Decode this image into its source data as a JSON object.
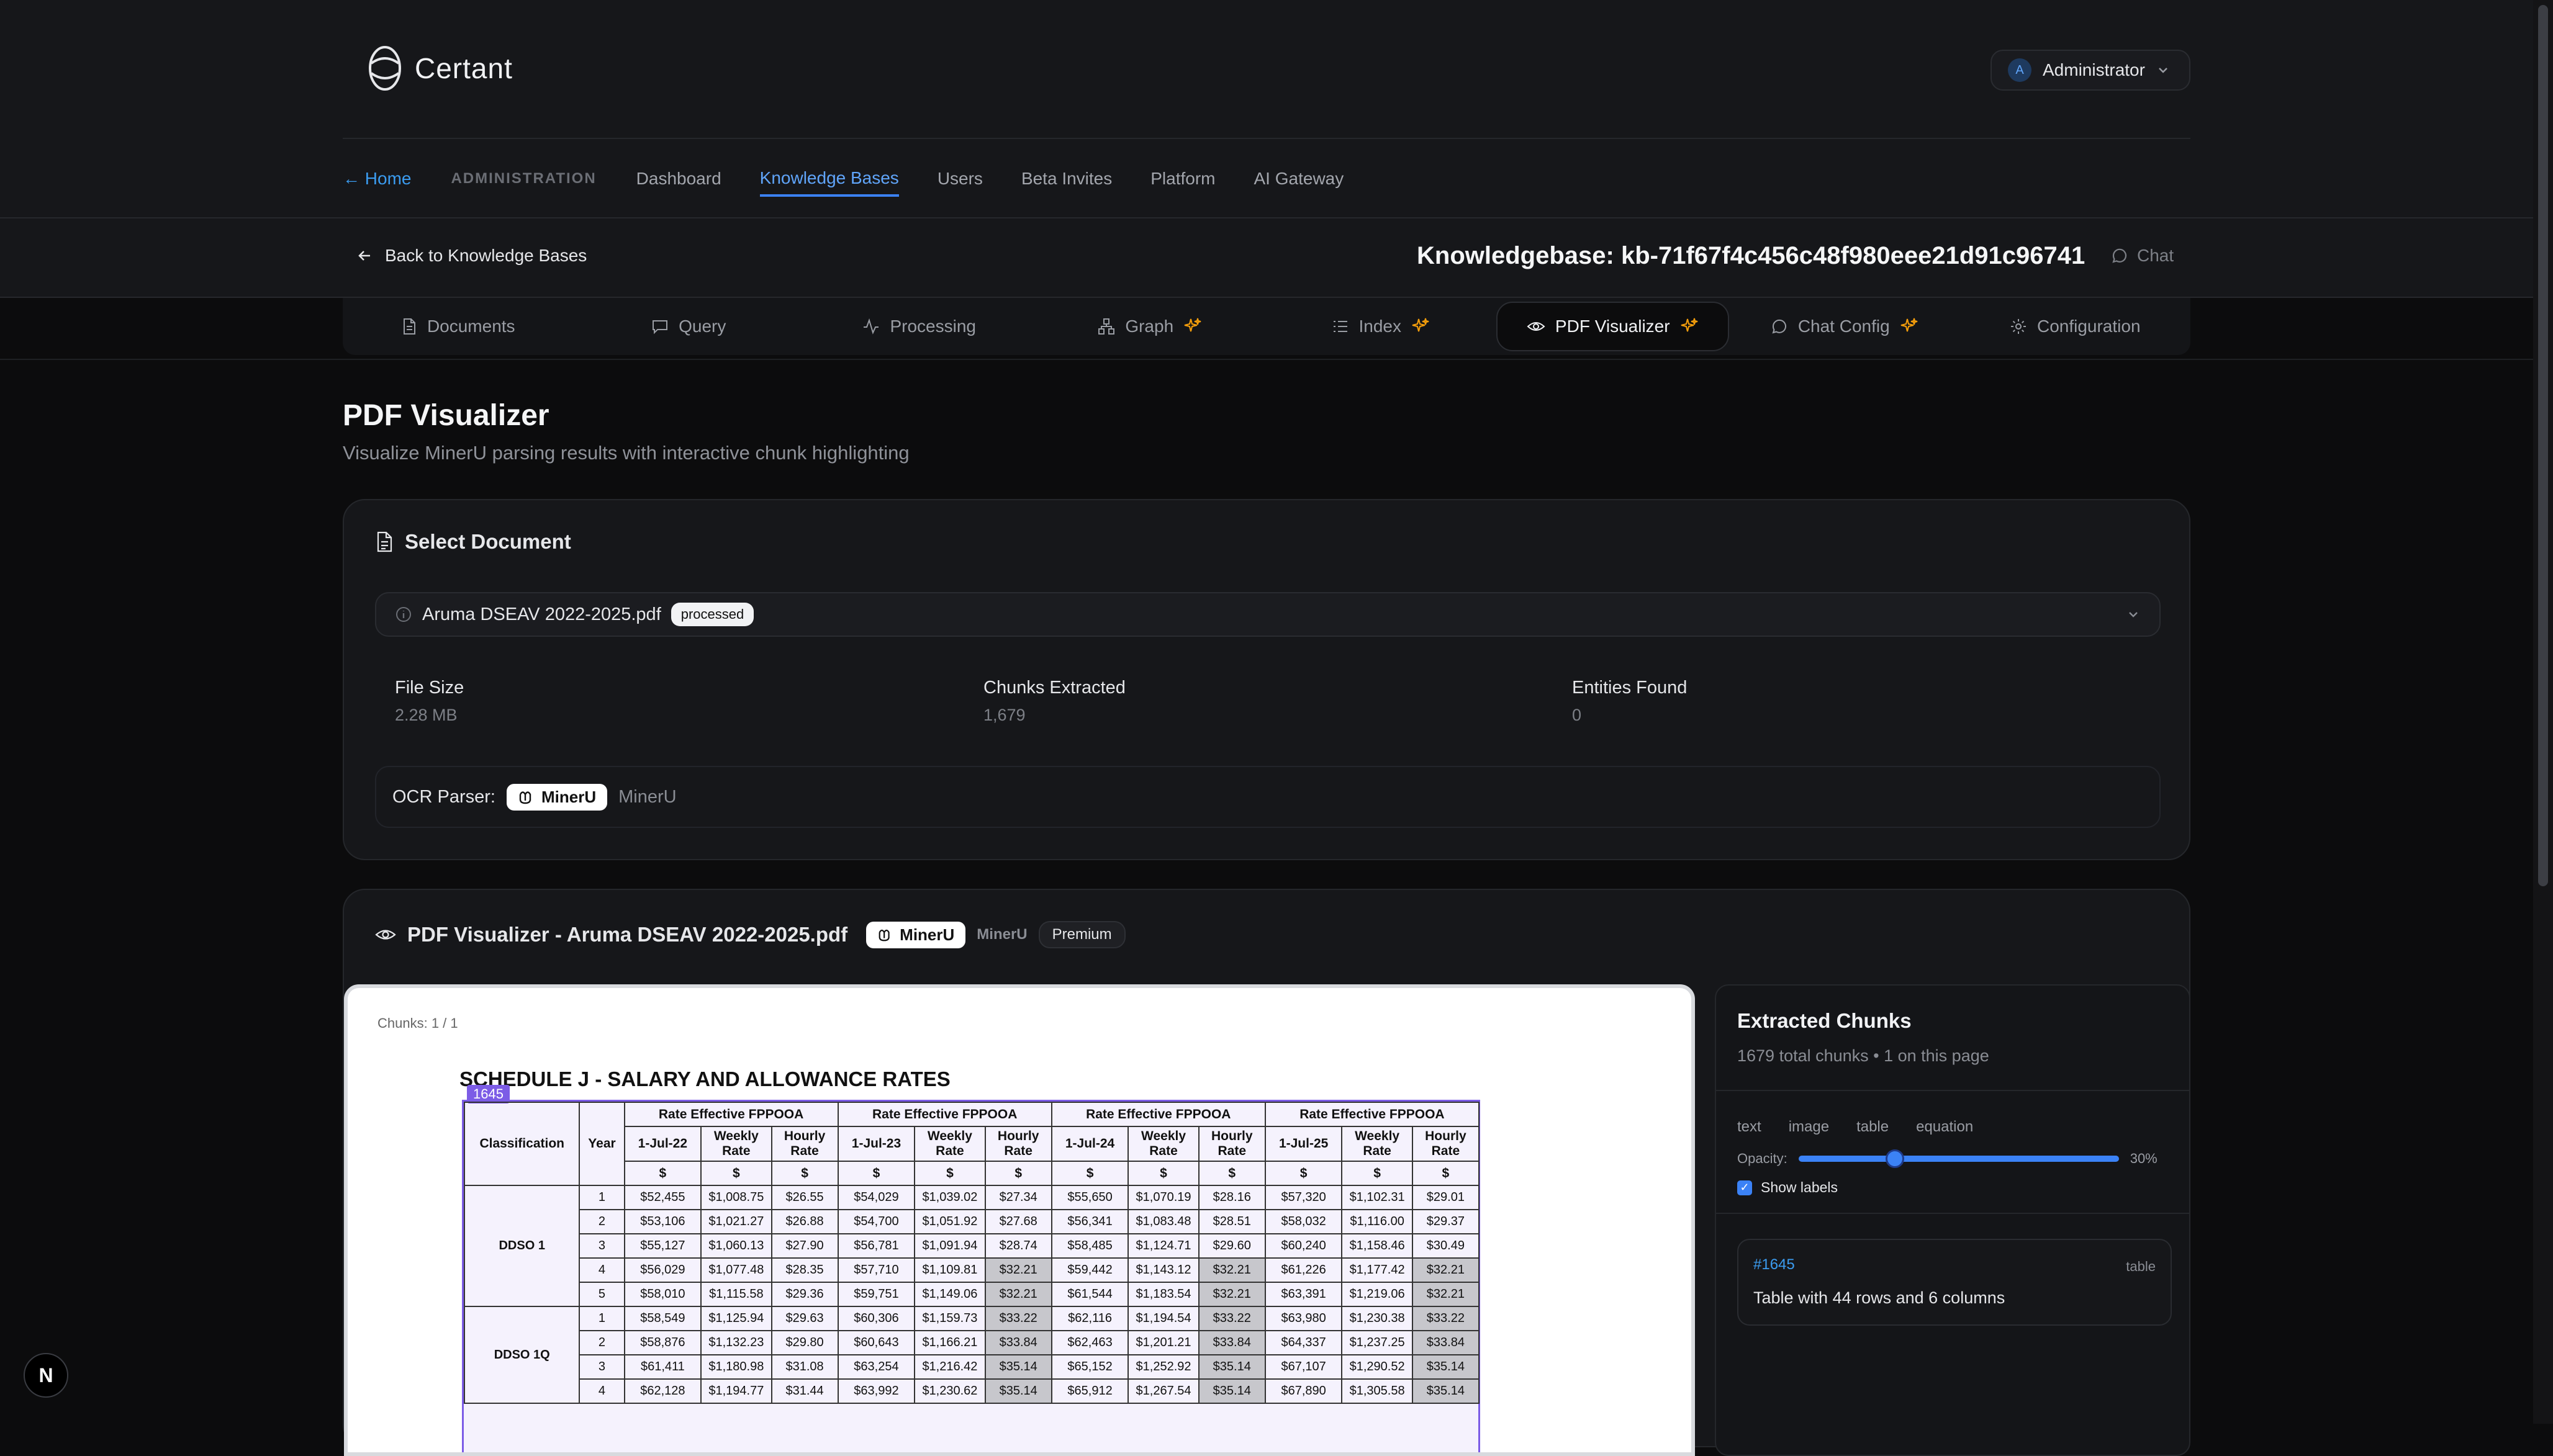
{
  "app": {
    "logo_text": "Certant",
    "user": {
      "initial": "A",
      "name": "Administrator"
    }
  },
  "nav": {
    "home": "← Home",
    "section": "ADMINISTRATION",
    "items": [
      "Dashboard",
      "Knowledge Bases",
      "Users",
      "Beta Invites",
      "Platform",
      "AI Gateway"
    ],
    "active": "Knowledge Bases"
  },
  "kb": {
    "back": "Back to Knowledge Bases",
    "title": "Knowledgebase: kb-71f67f4c456c48f980eee21d91c96741",
    "chat": "Chat"
  },
  "tabs": [
    {
      "label": "Documents",
      "icon": "document-icon"
    },
    {
      "label": "Query",
      "icon": "message-icon"
    },
    {
      "label": "Processing",
      "icon": "activity-icon"
    },
    {
      "label": "Graph",
      "icon": "graph-icon",
      "premium": true
    },
    {
      "label": "Index",
      "icon": "list-icon",
      "premium": true
    },
    {
      "label": "PDF Visualizer",
      "icon": "eye-icon",
      "premium": true,
      "active": true
    },
    {
      "label": "Chat Config",
      "icon": "message-icon",
      "premium": true
    },
    {
      "label": "Configuration",
      "icon": "gear-icon"
    }
  ],
  "page": {
    "title": "PDF Visualizer",
    "subtitle": "Visualize MinerU parsing results with interactive chunk highlighting"
  },
  "select_doc": {
    "heading": "Select Document",
    "selected_file": "Aruma DSEAV 2022-2025.pdf",
    "status": "processed",
    "stats": [
      {
        "label": "File Size",
        "value": "2.28 MB"
      },
      {
        "label": "Chunks Extracted",
        "value": "1,679"
      },
      {
        "label": "Entities Found",
        "value": "0"
      }
    ],
    "ocr_label": "OCR Parser:",
    "ocr_chip": "MinerU",
    "ocr_name": "MinerU"
  },
  "viz": {
    "heading": "PDF Visualizer - Aruma DSEAV 2022-2025.pdf",
    "chip": "MinerU",
    "parser": "MinerU",
    "premium": "Premium",
    "chunks_indicator": "Chunks: 1 / 1",
    "pdf_heading": "SCHEDULE J - SALARY AND ALLOWANCE RATES",
    "chunk_tag": "1645",
    "table": {
      "h_class": "Classification",
      "h_year": "Year",
      "h_rate": "Rate Effective FPPOOA",
      "periods": [
        "1-Jul-22",
        "1-Jul-23",
        "1-Jul-24",
        "1-Jul-25"
      ],
      "weekly": "Weekly Rate",
      "hourly": "Hourly Rate",
      "dollar": "$",
      "groups": [
        {
          "name": "DDSO 1",
          "rows": [
            [
              "1",
              "$52,455",
              "$1,008.75",
              "$26.55",
              "$54,029",
              "$1,039.02",
              "$27.34",
              "$55,650",
              "$1,070.19",
              "$28.16",
              "$57,320",
              "$1,102.31",
              "$29.01"
            ],
            [
              "2",
              "$53,106",
              "$1,021.27",
              "$26.88",
              "$54,700",
              "$1,051.92",
              "$27.68",
              "$56,341",
              "$1,083.48",
              "$28.51",
              "$58,032",
              "$1,116.00",
              "$29.37"
            ],
            [
              "3",
              "$55,127",
              "$1,060.13",
              "$27.90",
              "$56,781",
              "$1,091.94",
              "$28.74",
              "$58,485",
              "$1,124.71",
              "$29.60",
              "$60,240",
              "$1,158.46",
              "$30.49"
            ],
            [
              "4",
              "$56,029",
              "$1,077.48",
              "$28.35",
              "$57,710",
              "$1,109.81",
              "$32.21",
              "$59,442",
              "$1,143.12",
              "$32.21",
              "$61,226",
              "$1,177.42",
              "$32.21"
            ],
            [
              "5",
              "$58,010",
              "$1,115.58",
              "$29.36",
              "$59,751",
              "$1,149.06",
              "$32.21",
              "$61,544",
              "$1,183.54",
              "$32.21",
              "$63,391",
              "$1,219.06",
              "$32.21"
            ]
          ]
        },
        {
          "name": "DDSO 1Q",
          "rows": [
            [
              "1",
              "$58,549",
              "$1,125.94",
              "$29.63",
              "$60,306",
              "$1,159.73",
              "$33.22",
              "$62,116",
              "$1,194.54",
              "$33.22",
              "$63,980",
              "$1,230.38",
              "$33.22"
            ],
            [
              "2",
              "$58,876",
              "$1,132.23",
              "$29.80",
              "$60,643",
              "$1,166.21",
              "$33.84",
              "$62,463",
              "$1,201.21",
              "$33.84",
              "$64,337",
              "$1,237.25",
              "$33.84"
            ],
            [
              "3",
              "$61,411",
              "$1,180.98",
              "$31.08",
              "$63,254",
              "$1,216.42",
              "$35.14",
              "$65,152",
              "$1,252.92",
              "$35.14",
              "$67,107",
              "$1,290.52",
              "$35.14"
            ],
            [
              "4",
              "$62,128",
              "$1,194.77",
              "$31.44",
              "$63,992",
              "$1,230.62",
              "$35.14",
              "$65,912",
              "$1,267.54",
              "$35.14",
              "$67,890",
              "$1,305.58",
              "$35.14"
            ]
          ]
        }
      ]
    },
    "panel": {
      "title": "Extracted Chunks",
      "subtitle": "1679 total chunks • 1 on this page",
      "filters": [
        "text",
        "image",
        "table",
        "equation"
      ],
      "opacity_label": "Opacity:",
      "opacity_value": "30%",
      "opacity_fraction": 0.3,
      "show_labels": "Show labels",
      "chunk": {
        "id": "#1645",
        "type": "table",
        "desc": "Table with 44 rows and 6 columns"
      }
    }
  },
  "colors": {
    "accent": "#3b82f6",
    "premium_spark": "#f59e0b",
    "chunk_highlight": "#7c5ce6"
  }
}
